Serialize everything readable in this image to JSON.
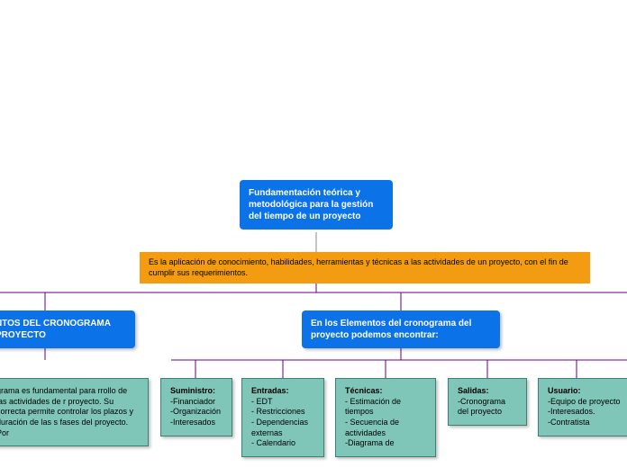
{
  "root": {
    "title": "Fundamentación teórica y metodológica para la gestión del tiempo de un proyecto"
  },
  "definition": "Es la aplicación de conocimiento, habilidades, herramientas y técnicas a las actividades de un proyecto, con el fin de cumplir sus requerimientos.",
  "left_branch": {
    "title": "NTOS DEL CRONOGRAMA PROYECTO",
    "body": "grama es fundamental para rrollo de las actividades de r proyecto. Su correcta permite controlar los plazos y duración de las s fases del proyecto. Por"
  },
  "right_branch": {
    "title": "En los Elementos del cronograma del proyecto podemos encontrar:"
  },
  "children": [
    {
      "title": "Suministro:",
      "items": [
        "-Financiador",
        "-Organización",
        "-Interesados"
      ]
    },
    {
      "title": "Entradas:",
      "items": [
        "- EDT",
        "- Restricciones",
        "- Dependencias externas",
        "- Calendario"
      ]
    },
    {
      "title": "Técnicas:",
      "items": [
        "- Estimación de tiempos",
        "- Secuencia de actividades",
        "-Diagrama de"
      ]
    },
    {
      "title": "Salidas:",
      "items": [
        "-Cronograma del proyecto"
      ]
    },
    {
      "title": "Usuario:",
      "items": [
        "-Equipo de proyecto",
        "-Interesados.",
        "-Contratista"
      ]
    }
  ]
}
